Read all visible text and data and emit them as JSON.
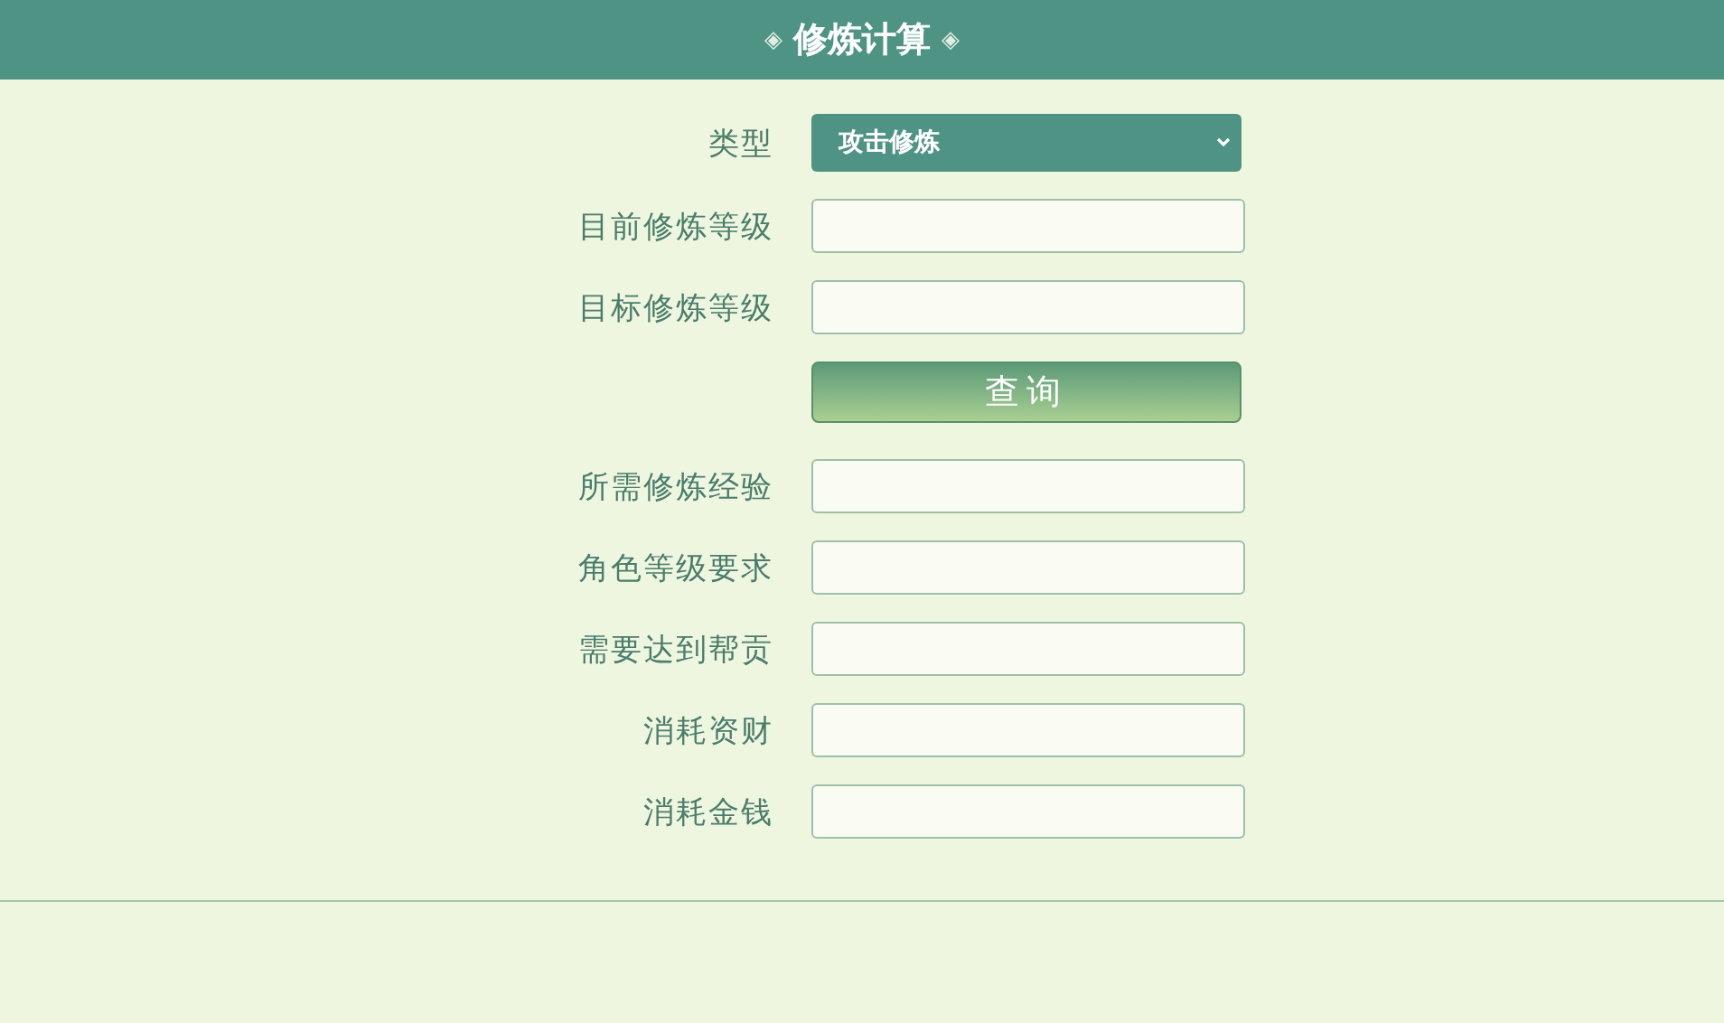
{
  "header": {
    "title": "修炼计算",
    "ornament": "◈"
  },
  "rows": [
    {
      "kind": "select",
      "label": "类型",
      "value": "攻击修炼"
    },
    {
      "kind": "input",
      "label": "目前修炼等级"
    },
    {
      "kind": "input",
      "label": "目标修炼等级"
    },
    {
      "kind": "button",
      "label": "查询"
    },
    {
      "kind": "input",
      "label": "所需修炼经验"
    },
    {
      "kind": "input",
      "label": "角色等级要求"
    },
    {
      "kind": "input",
      "label": "需要达到帮贡"
    },
    {
      "kind": "input",
      "label": "消耗资财"
    },
    {
      "kind": "input",
      "label": "消耗金钱"
    }
  ]
}
